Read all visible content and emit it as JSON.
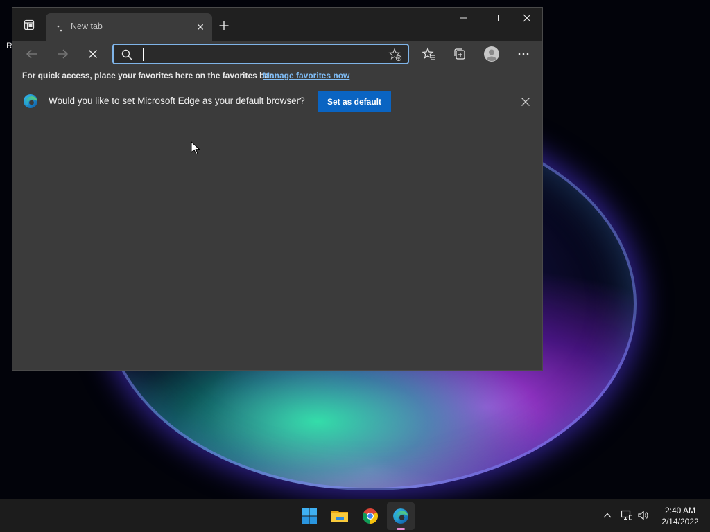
{
  "desktop": {
    "label": "R"
  },
  "browser": {
    "tab": {
      "title": "New tab",
      "close_symbol": "✕"
    },
    "address_bar": {
      "value": "",
      "placeholder": ""
    },
    "favorites_bar": {
      "text": "For quick access, place your favorites here on the favorites bar.",
      "link": "Manage favorites now"
    },
    "default_banner": {
      "text": "Would you like to set Microsoft Edge as your default browser?",
      "button_label": "Set as default"
    },
    "icons": {
      "tab_actions": "tab-actions-icon",
      "new_tab": "plus-icon",
      "back": "arrow-left-icon",
      "forward": "arrow-right-icon",
      "stop": "close-icon",
      "search": "search-icon",
      "add_favorite": "star-plus-icon",
      "favorites": "favorites-icon",
      "collections": "collections-icon",
      "profile": "profile-icon",
      "more": "more-icon"
    },
    "colors": {
      "accent": "#0a64c2",
      "link": "#7fbcf5",
      "focus_border": "#7fb4e8",
      "window_bg": "#3b3b3b",
      "titlebar_bg": "#202020"
    }
  },
  "taskbar": {
    "apps": [
      "start",
      "file-explorer",
      "google-chrome",
      "microsoft-edge"
    ],
    "clock": {
      "time": "2:40 AM",
      "date": "2/14/2022"
    }
  }
}
